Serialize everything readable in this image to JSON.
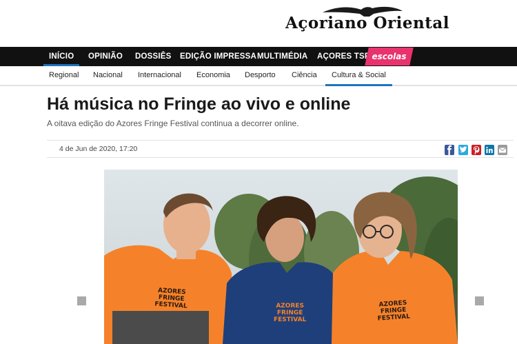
{
  "brand": {
    "name": "Açoriano Oriental"
  },
  "main_nav": {
    "items": [
      {
        "label": "INÍCIO",
        "active": true
      },
      {
        "label": "OPINIÃO"
      },
      {
        "label": "DOSSIÊS"
      },
      {
        "label": "EDIÇÃO IMPRESSA"
      },
      {
        "label": "MULTIMÉDIA"
      },
      {
        "label": "AÇORES TSF"
      }
    ],
    "escolas_label": "escolas"
  },
  "sub_nav": {
    "items": [
      {
        "label": "Regional"
      },
      {
        "label": "Nacional"
      },
      {
        "label": "Internacional"
      },
      {
        "label": "Economia"
      },
      {
        "label": "Desporto"
      },
      {
        "label": "Ciência"
      },
      {
        "label": "Cultura & Social",
        "active": true
      }
    ]
  },
  "article": {
    "title": "Há música no Fringe ao vivo e online",
    "lead": "A oitava edição do Azores Fringe Festival continua a decorrer online.",
    "date": "4 de Jun de 2020, 17:20",
    "share_icons": [
      "facebook-icon",
      "twitter-icon",
      "pinterest-icon",
      "linkedin-icon",
      "email-icon"
    ],
    "photo": {
      "shirt_text": [
        "AZORES",
        "FRINGE",
        "FESTIVAL"
      ]
    }
  },
  "colors": {
    "nav_bg": "#111111",
    "accent_blue": "#1e73be",
    "escolas_pink": "#e8336e",
    "shirt_orange": "#f5822a",
    "shirt_navy": "#1f3f7a"
  }
}
